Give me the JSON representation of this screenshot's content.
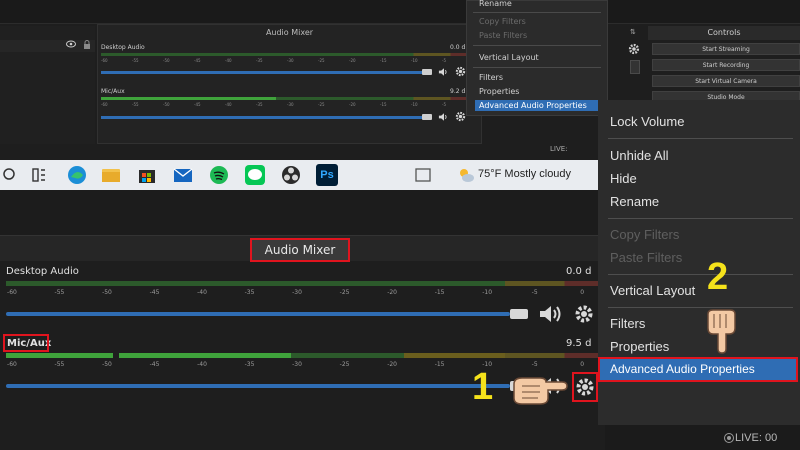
{
  "top_inset": {
    "mixer_title": "Audio Mixer",
    "desktop_label": "Desktop Audio",
    "desktop_value": "0.0 d",
    "mic_label": "Mic/Aux",
    "mic_value": "9.2 d",
    "ticks": [
      "-60",
      "-55",
      "-50",
      "-45",
      "-40",
      "-35",
      "-30",
      "-25",
      "-20",
      "-15",
      "-10",
      "-5",
      "0"
    ],
    "menu_items": [
      {
        "label": "Rename",
        "disabled": false
      },
      {
        "label": "Copy Filters",
        "disabled": true
      },
      {
        "label": "Paste Filters",
        "disabled": true
      },
      {
        "label": "Vertical Layout",
        "disabled": false
      },
      {
        "label": "Filters",
        "disabled": false
      },
      {
        "label": "Properties",
        "disabled": false
      },
      {
        "label": "Advanced Audio Properties",
        "disabled": false,
        "highlighted": true
      }
    ],
    "controls_title": "Controls",
    "controls": [
      "Start Streaming",
      "Start Recording",
      "Start Virtual Camera",
      "Studio Mode"
    ],
    "live": "LIVE:"
  },
  "taskbar": {
    "weather": "75°F  Mostly cloudy",
    "icons": [
      "search-icon",
      "task-view-icon",
      "edge-icon",
      "file-explorer-icon",
      "store-icon",
      "mail-icon",
      "spotify-icon",
      "line-icon",
      "obs-icon",
      "photoshop-icon",
      "weather-icon"
    ],
    "ps_label": "Ps"
  },
  "mixer": {
    "title": "Audio Mixer",
    "channels": [
      {
        "label": "Desktop Audio",
        "value": "0.0 d"
      },
      {
        "label": "Mic/Aux",
        "value": "9.5 d"
      }
    ],
    "ticks": [
      "-60",
      "-55",
      "-50",
      "-45",
      "-40",
      "-35",
      "-30",
      "-25",
      "-20",
      "-15",
      "-10",
      "-5",
      "0"
    ]
  },
  "context_menu": {
    "items": [
      {
        "label": "Lock Volume",
        "disabled": false
      },
      {
        "label": "Unhide All",
        "disabled": false
      },
      {
        "label": "Hide",
        "disabled": false
      },
      {
        "label": "Rename",
        "disabled": false
      },
      {
        "label": "Copy Filters",
        "disabled": true
      },
      {
        "label": "Paste Filters",
        "disabled": true
      },
      {
        "label": "Vertical Layout",
        "disabled": false
      },
      {
        "label": "Filters",
        "disabled": false
      },
      {
        "label": "Properties",
        "disabled": false
      }
    ],
    "highlighted": "Advanced Audio Properties"
  },
  "steps": [
    "1",
    "2"
  ],
  "status": {
    "live": "LIVE: 00"
  },
  "colors": {
    "accent": "#2f6db4",
    "highlight_box": "#e0141e",
    "step_number": "#f5e21b",
    "meter_green": "#3fa33b",
    "meter_yellow": "#b3a22a",
    "meter_red": "#b8392f"
  }
}
